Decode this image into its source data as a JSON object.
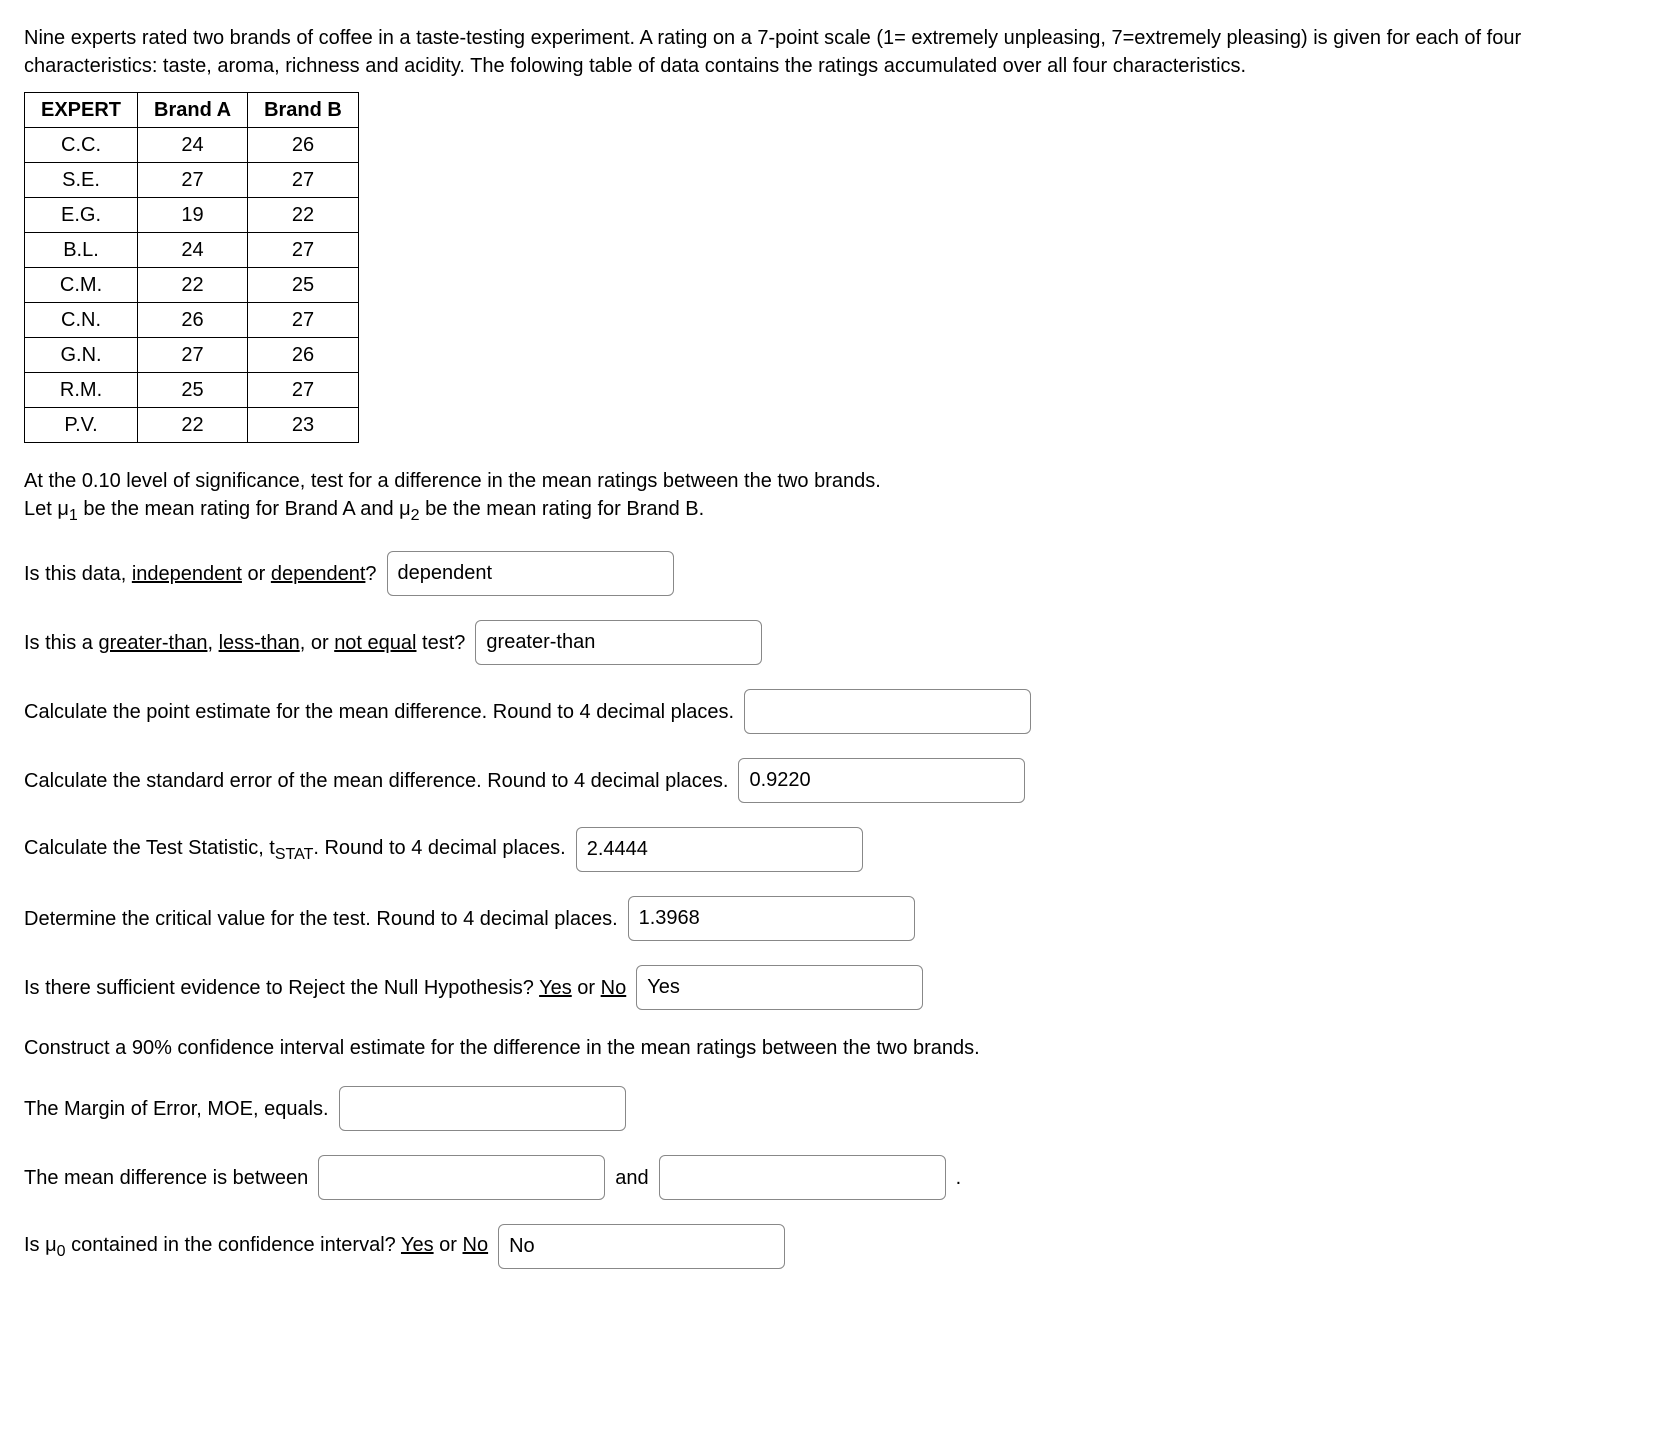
{
  "intro": "Nine experts rated two brands of coffee in a taste-testing experiment. A rating on a 7-point scale (1= extremely unpleasing, 7=extremely pleasing) is given for each of four characteristics: taste, aroma, richness and acidity. The folowing table of data contains the ratings accumulated over all four characteristics.",
  "table": {
    "headers": {
      "expert": "EXPERT",
      "a": "Brand A",
      "b": "Brand B"
    },
    "rows": [
      {
        "expert": "C.C.",
        "a": "24",
        "b": "26"
      },
      {
        "expert": "S.E.",
        "a": "27",
        "b": "27"
      },
      {
        "expert": "E.G.",
        "a": "19",
        "b": "22"
      },
      {
        "expert": "B.L.",
        "a": "24",
        "b": "27"
      },
      {
        "expert": "C.M.",
        "a": "22",
        "b": "25"
      },
      {
        "expert": "C.N.",
        "a": "26",
        "b": "27"
      },
      {
        "expert": "G.N.",
        "a": "27",
        "b": "26"
      },
      {
        "expert": "R.M.",
        "a": "25",
        "b": "27"
      },
      {
        "expert": "P.V.",
        "a": "22",
        "b": "23"
      }
    ]
  },
  "setup": {
    "sig": "At the 0.10 level of significance, test for a difference in the mean ratings between the two brands.",
    "let_pre": "Let μ",
    "let_mid1": " be the mean rating for Brand A and μ",
    "let_mid2": " be the mean rating for Brand B.",
    "sub1": "1",
    "sub2": "2"
  },
  "q1": {
    "pre": "Is this data, ",
    "u1": "independent",
    "or": " or ",
    "u2": "dependent",
    "post": "?",
    "answer": "dependent"
  },
  "q2": {
    "pre": "Is this a ",
    "u1": "greater-than",
    "c1": ", ",
    "u2": "less-than",
    "c2": ", or ",
    "u3": "not equal",
    "post": " test?",
    "answer": "greater-than"
  },
  "q3": {
    "text": "Calculate the point estimate for the mean difference. Round to 4 decimal places.",
    "answer": ""
  },
  "q4": {
    "text": "Calculate the standard error of the mean difference. Round to 4 decimal places.",
    "answer": "0.9220"
  },
  "q5": {
    "pre": "Calculate the Test Statistic, t",
    "sub": "STAT",
    "post": ". Round to 4 decimal places.",
    "answer": "2.4444"
  },
  "q6": {
    "text": "Determine the critical value for the test. Round to 4 decimal places.",
    "answer": "1.3968"
  },
  "q7": {
    "pre": "Is there sufficient evidence to Reject the Null Hypothesis? ",
    "u1": "Yes",
    "or": " or ",
    "u2": "No",
    "answer": "Yes"
  },
  "ci_intro": "Construct a 90% confidence interval estimate for the difference in the mean ratings between the two brands.",
  "q8": {
    "text": "The Margin of Error, MOE, equals.",
    "answer": ""
  },
  "q9": {
    "pre": "The mean difference is between",
    "and": "and",
    "dot": ".",
    "low": "",
    "high": ""
  },
  "q10": {
    "pre1": "Is μ",
    "sub": "0",
    "pre2": " contained in the confidence interval? ",
    "u1": "Yes",
    "or": " or ",
    "u2": "No",
    "answer": "No"
  }
}
